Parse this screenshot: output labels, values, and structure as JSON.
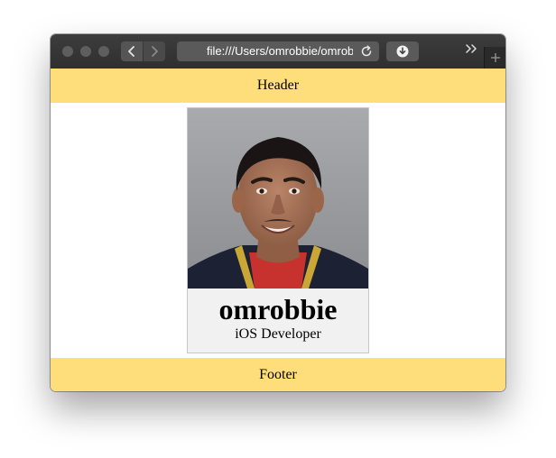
{
  "browser": {
    "address_url": "file:///Users/omrobbie/omrobbie"
  },
  "page": {
    "header_text": "Header",
    "footer_text": "Footer"
  },
  "profile": {
    "name": "omrobbie",
    "role": "iOS Developer"
  },
  "icons": {
    "back": "chevron-left-icon",
    "forward": "chevron-right-icon",
    "reload": "reload-icon",
    "download": "download-icon",
    "overflow": "double-chevron-right-icon",
    "new_tab": "plus-icon"
  },
  "colors": {
    "header_footer_bg": "#fede7a",
    "toolbar_bg": "#333333",
    "card_bg": "#f1f1f1"
  }
}
